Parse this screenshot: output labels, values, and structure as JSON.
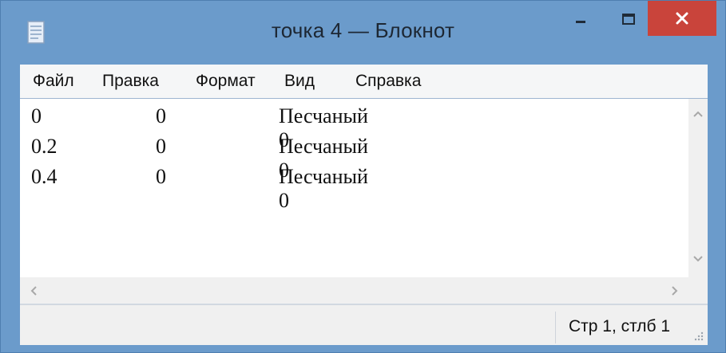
{
  "window": {
    "title": "точка 4 — Блокнот",
    "accent_color": "#6b9bcb",
    "close_color": "#c9443b",
    "controls": {
      "minimize_icon": "minimize-icon",
      "maximize_icon": "maximize-icon",
      "close_icon": "close-icon"
    }
  },
  "menu": {
    "file": "Файл",
    "edit": "Правка",
    "format": "Формат",
    "view": "Вид",
    "help": "Справка"
  },
  "document": {
    "lines": [
      {
        "col1": "0",
        "col2": "0",
        "col3": "Песчаный 0"
      },
      {
        "col1": "0.2",
        "col2": "0",
        "col3": "Песчаный 0"
      },
      {
        "col1": "0.4",
        "col2": "0",
        "col3": "Песчаный 0"
      }
    ]
  },
  "status": {
    "position": "Стр 1, стлб 1"
  }
}
